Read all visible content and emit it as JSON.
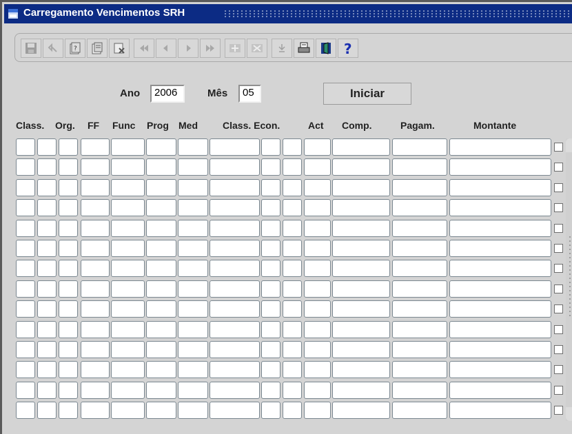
{
  "window": {
    "title": "Carregamento Vencimentos SRH"
  },
  "toolbar": {
    "buttons": [
      {
        "name": "save-icon"
      },
      {
        "name": "undo-icon"
      },
      {
        "name": "query-icon"
      },
      {
        "name": "copy-record-icon"
      },
      {
        "name": "clear-record-icon"
      },
      {
        "name": "first-record-icon"
      },
      {
        "name": "previous-record-icon"
      },
      {
        "name": "next-record-icon"
      },
      {
        "name": "last-record-icon"
      },
      {
        "name": "insert-record-icon"
      },
      {
        "name": "delete-record-icon"
      },
      {
        "name": "list-values-icon"
      },
      {
        "name": "print-icon"
      },
      {
        "name": "exit-icon"
      },
      {
        "name": "help-icon"
      }
    ]
  },
  "form": {
    "ano_label": "Ano",
    "ano_value": "2006",
    "mes_label": "Mês",
    "mes_value": "05",
    "start_button": "Iniciar"
  },
  "table": {
    "headers": [
      "Class.",
      "Org.",
      "FF",
      "Func",
      "Prog",
      "Med",
      "Class. Econ.",
      "Act",
      "Comp.",
      "Pagam.",
      "Montante"
    ],
    "row_count": 14
  },
  "colors": {
    "titlebar": "#0c2b84",
    "background": "#d4d4d4",
    "field": "#ffffff"
  }
}
